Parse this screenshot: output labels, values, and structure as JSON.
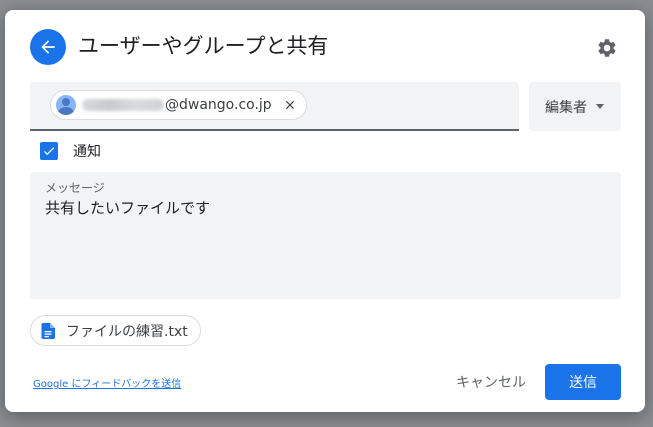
{
  "dialog": {
    "title": "ユーザーやグループと共有",
    "icons": {
      "back": "arrow-back-icon",
      "settings": "gear-icon",
      "avatar": "person-avatar-icon",
      "remove": "close-icon",
      "caret": "caret-down-icon",
      "checkbox": "checkmark-icon",
      "file": "document-icon"
    },
    "colors": {
      "accent": "#1a73e8",
      "field_bg": "#f1f3f4"
    }
  },
  "recipients": [
    {
      "email_visible_part": "@dwango.co.jp"
    }
  ],
  "role_select": {
    "selected": "編集者"
  },
  "notify": {
    "label": "通知",
    "checked": true
  },
  "message": {
    "label": "メッセージ",
    "value": "共有したいファイルです"
  },
  "attachment": {
    "file_name": "ファイルの練習.txt"
  },
  "footer": {
    "feedback_link": "Google にフィードバックを送信",
    "cancel_label": "キャンセル",
    "send_label": "送信"
  }
}
